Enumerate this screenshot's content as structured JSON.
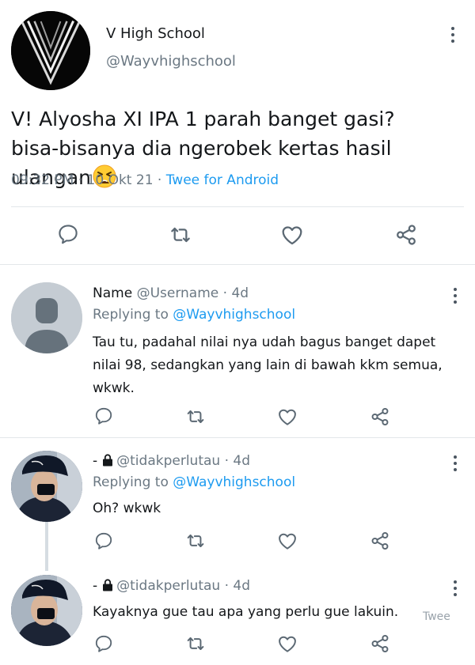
{
  "main_tweet": {
    "name": "V High School",
    "handle": "@Wayvhighschool",
    "text_line1": "V! Alyosha XI IPA 1 parah banget gasi?",
    "text_line2": "bisa-bisanya dia ngerobek kertas hasil ulangan",
    "emoji": "tired-face-emoji",
    "time": "09:32 PM",
    "date": "10 Okt 21",
    "client": "Twee for Android"
  },
  "replies": [
    {
      "display_name": "Name",
      "username": "@Username",
      "age": "4d",
      "replying_label": "Replying to",
      "replying_to": "@Wayvhighschool",
      "text": "Tau tu, padahal nilai nya udah bagus banget dapet nilai 98, sedangkan yang lain di bawah kkm semua, wkwk."
    },
    {
      "display_name": "-",
      "username": "@tidakperlutau",
      "age": "4d",
      "replying_label": "Replying to",
      "replying_to": "@Wayvhighschool",
      "text": "Oh? wkwk"
    },
    {
      "display_name": "-",
      "username": "@tidakperlutau",
      "age": "4d",
      "text": "Kayaknya gue tau apa yang perlu gue lakuin."
    }
  ],
  "watermark": "Twee",
  "separator": "·",
  "icons": [
    "reply-icon",
    "retweet-icon",
    "like-icon",
    "share-icon",
    "more-options-icon",
    "lock-icon"
  ],
  "colors": {
    "link": "#1d9bf0",
    "muted": "#6b7883",
    "text": "#14171a"
  }
}
